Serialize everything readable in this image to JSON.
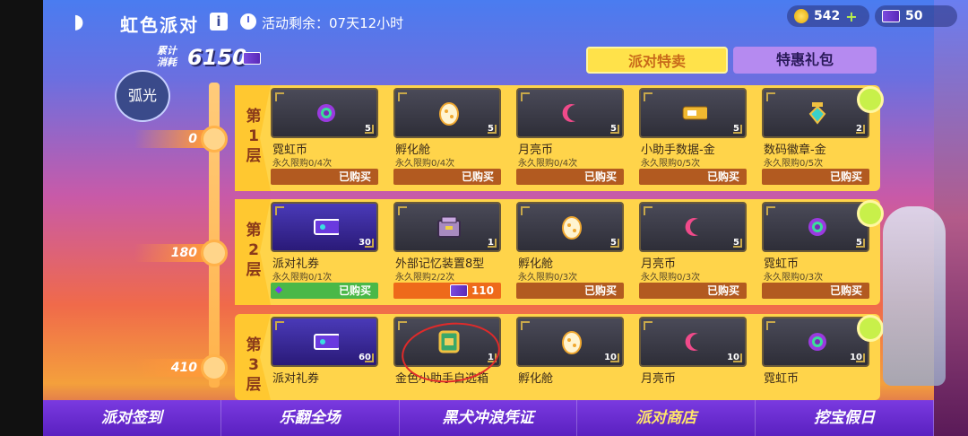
{
  "header": {
    "title": "虹色派对",
    "timer": "活动剩余：07天12小时"
  },
  "currency": {
    "gold": "542",
    "tickets": "50"
  },
  "cumulative": {
    "label": "累计 消耗",
    "value": "6150"
  },
  "tabs": [
    {
      "label": "派对特卖",
      "active": true
    },
    {
      "label": "特惠礼包",
      "active": false
    }
  ],
  "character": "弧光",
  "floors": [
    {
      "cost": "0",
      "label": "第1层",
      "items": [
        {
          "name": "霓虹币",
          "limit": "永久限购0/4次",
          "qty": "5",
          "button": "已购买",
          "icon": "neon-coin"
        },
        {
          "name": "孵化舱",
          "limit": "永久限购0/4次",
          "qty": "5",
          "button": "已购买",
          "icon": "egg"
        },
        {
          "name": "月亮币",
          "limit": "永久限购0/4次",
          "qty": "5",
          "button": "已购买",
          "icon": "moon-coin"
        },
        {
          "name": "小助手数据-金",
          "limit": "永久限购0/5次",
          "qty": "5",
          "button": "已购买",
          "icon": "data-chip"
        },
        {
          "name": "数码徽章-金",
          "limit": "永久限购0/5次",
          "qty": "2",
          "button": "已购买",
          "icon": "badge"
        }
      ]
    },
    {
      "cost": "180",
      "label": "第2层",
      "items": [
        {
          "name": "派对礼券",
          "limit": "永久限购0/1次",
          "qty": "30",
          "button": "已购买",
          "icon": "ticket",
          "style": "green"
        },
        {
          "name": "外部记忆装置8型",
          "limit": "永久限购2/2次",
          "qty": "1",
          "button": "110",
          "icon": "chest",
          "style": "orange"
        },
        {
          "name": "孵化舱",
          "limit": "永久限购0/3次",
          "qty": "5",
          "button": "已购买",
          "icon": "egg"
        },
        {
          "name": "月亮币",
          "limit": "永久限购0/3次",
          "qty": "5",
          "button": "已购买",
          "icon": "moon-coin"
        },
        {
          "name": "霓虹币",
          "limit": "永久限购0/3次",
          "qty": "5",
          "button": "已购买",
          "icon": "neon-coin"
        }
      ]
    },
    {
      "cost": "410",
      "label": "第3层",
      "items": [
        {
          "name": "派对礼券",
          "qty": "60",
          "icon": "ticket"
        },
        {
          "name": "金色小助手自选箱",
          "qty": "1",
          "icon": "gold-box"
        },
        {
          "name": "孵化舱",
          "qty": "10",
          "icon": "egg"
        },
        {
          "name": "月亮币",
          "qty": "10",
          "icon": "moon-coin"
        },
        {
          "name": "霓虹币",
          "qty": "10",
          "icon": "neon-coin"
        }
      ]
    }
  ],
  "bottom_nav": [
    {
      "label": "派对签到",
      "active": false
    },
    {
      "label": "乐翻全场",
      "active": false
    },
    {
      "label": "黑犬冲浪凭证",
      "active": false
    },
    {
      "label": "派对商店",
      "active": true
    },
    {
      "label": "挖宝假日",
      "active": false
    }
  ]
}
